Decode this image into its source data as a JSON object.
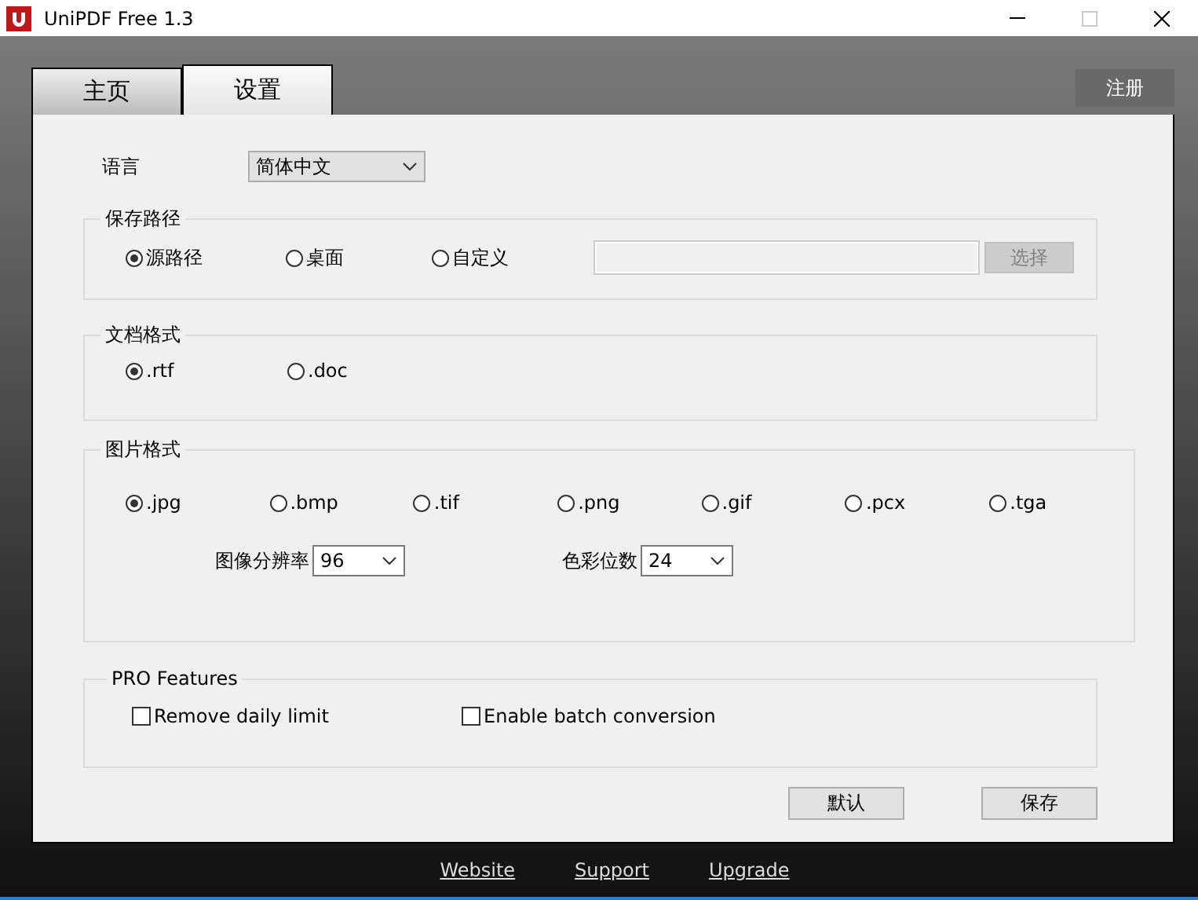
{
  "window": {
    "title": "UniPDF Free 1.3"
  },
  "tabs": [
    {
      "label": "主页",
      "selected": false
    },
    {
      "label": "设置",
      "selected": true
    }
  ],
  "register_button": "注册",
  "language": {
    "label": "语言",
    "value": "简体中文"
  },
  "save_path": {
    "title": "保存路径",
    "options": [
      {
        "label": "源路径",
        "selected": true
      },
      {
        "label": "桌面",
        "selected": false
      },
      {
        "label": "自定义",
        "selected": false
      }
    ],
    "choose_button": {
      "label": "选择",
      "disabled": true
    }
  },
  "document_format": {
    "title": "文档格式",
    "options": [
      {
        "label": ".rtf",
        "selected": true
      },
      {
        "label": ".doc",
        "selected": false
      }
    ]
  },
  "image_format": {
    "title": "图片格式",
    "options": [
      {
        "label": ".jpg",
        "selected": true
      },
      {
        "label": ".bmp",
        "selected": false
      },
      {
        "label": ".tif",
        "selected": false
      },
      {
        "label": ".png",
        "selected": false
      },
      {
        "label": ".gif",
        "selected": false
      },
      {
        "label": ".pcx",
        "selected": false
      },
      {
        "label": ".tga",
        "selected": false
      }
    ],
    "resolution": {
      "label": "图像分辨率",
      "value": "96"
    },
    "color_depth": {
      "label": "色彩位数",
      "value": "24"
    }
  },
  "pro_features": {
    "title": "PRO Features",
    "options": [
      {
        "label": "Remove daily limit",
        "checked": false
      },
      {
        "label": "Enable batch conversion",
        "checked": false
      }
    ]
  },
  "buttons": [
    "默认",
    "保存"
  ],
  "footer_links": [
    "Website",
    "Support",
    "Upgrade"
  ]
}
